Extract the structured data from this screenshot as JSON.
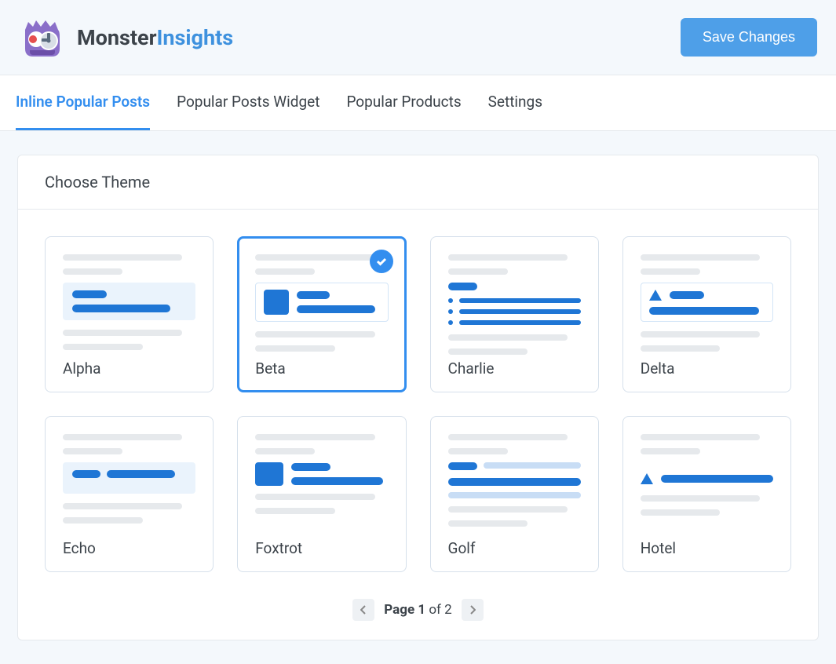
{
  "header": {
    "logo_text_1": "Monster",
    "logo_text_2": "Insights",
    "save_label": "Save Changes"
  },
  "tabs": [
    {
      "label": "Inline Popular Posts",
      "active": true
    },
    {
      "label": "Popular Posts Widget",
      "active": false
    },
    {
      "label": "Popular Products",
      "active": false
    },
    {
      "label": "Settings",
      "active": false
    }
  ],
  "panel": {
    "title": "Choose Theme"
  },
  "themes": [
    {
      "name": "Alpha",
      "selected": false
    },
    {
      "name": "Beta",
      "selected": true
    },
    {
      "name": "Charlie",
      "selected": false
    },
    {
      "name": "Delta",
      "selected": false
    },
    {
      "name": "Echo",
      "selected": false
    },
    {
      "name": "Foxtrot",
      "selected": false
    },
    {
      "name": "Golf",
      "selected": false
    },
    {
      "name": "Hotel",
      "selected": false
    }
  ],
  "pagination": {
    "prefix": "Page ",
    "current": "1",
    "of": " of ",
    "total": "2"
  }
}
